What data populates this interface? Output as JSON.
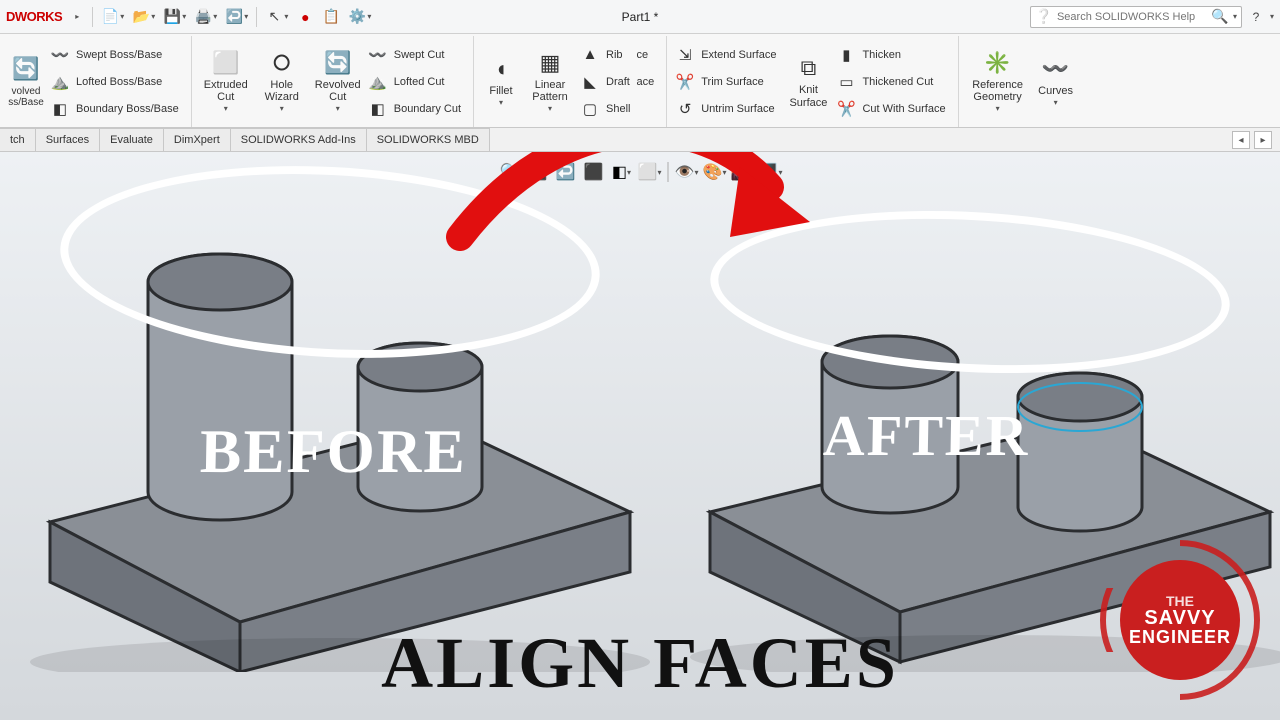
{
  "app": {
    "logo_text": "WORKS",
    "doc_title": "Part1 *"
  },
  "search": {
    "placeholder": "Search SOLIDWORKS Help"
  },
  "qat": {
    "items": [
      "new-icon",
      "open-icon",
      "save-icon",
      "print-icon",
      "undo-icon",
      "select-icon",
      "rebuild-icon",
      "options-icon",
      "settings-icon"
    ]
  },
  "ribbon": {
    "boss_list": [
      "Swept Boss/Base",
      "Lofted Boss/Base",
      "Boundary Boss/Base"
    ],
    "big1": {
      "label": "Extruded Cut"
    },
    "big2": {
      "label": "Hole Wizard"
    },
    "big3": {
      "label": "Revolved Cut"
    },
    "cut_list": [
      "Swept Cut",
      "Lofted Cut",
      "Boundary Cut"
    ],
    "big4": {
      "label": "Fillet"
    },
    "big5": {
      "label": "Linear Pattern"
    },
    "misc_list": [
      "Rib",
      "Draft",
      "Shell"
    ],
    "mirror_suffix": [
      "ce",
      "ace",
      ""
    ],
    "surf_list": [
      "Extend Surface",
      "Trim Surface",
      "Untrim Surface"
    ],
    "big6": {
      "label": "Knit Surface"
    },
    "surf2_list": [
      "Thicken",
      "Thickened Cut",
      "Cut With Surface"
    ],
    "big7": {
      "label": "Reference Geometry"
    },
    "big8": {
      "label": "Curves"
    }
  },
  "doctabs": {
    "tabs": [
      "tch",
      "Surfaces",
      "Evaluate",
      "DimXpert",
      "SOLIDWORKS Add-Ins",
      "SOLIDWORKS MBD"
    ]
  },
  "captions": {
    "before": "BEFORE",
    "after": "AFTER",
    "title": "ALIGN FACES"
  },
  "badge": {
    "t1": "THE",
    "t2": "SAVVY",
    "t3": "ENGINEER"
  },
  "boss_left_big": "volved ss/Base"
}
